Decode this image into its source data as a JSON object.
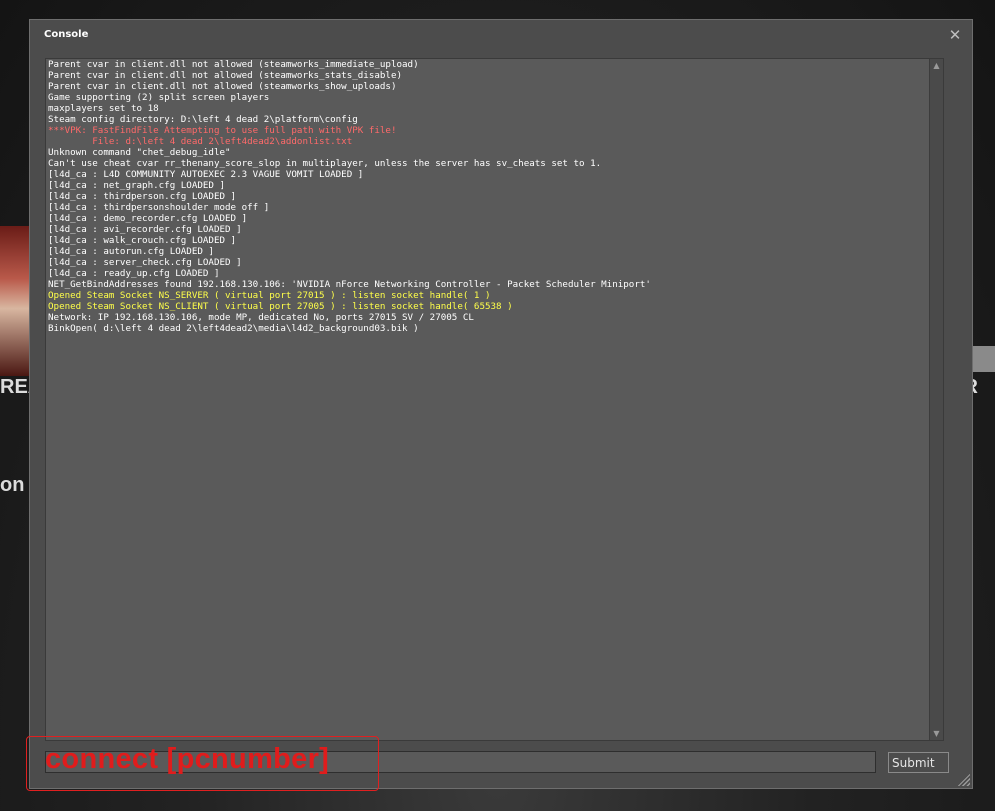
{
  "background": {
    "left_text_1": "REA",
    "left_text_2": "on",
    "right_text": "R"
  },
  "console": {
    "title": "Console",
    "close_glyph": "✕",
    "submit_label": "Submit",
    "input_value": "",
    "colors": {
      "normal": "#ffffff",
      "error": "#ff6a6a",
      "warning": "#ffff4a"
    },
    "log": [
      {
        "text": "Parent cvar in client.dll not allowed (steamworks_immediate_upload)",
        "level": "normal"
      },
      {
        "text": "Parent cvar in client.dll not allowed (steamworks_stats_disable)",
        "level": "normal"
      },
      {
        "text": "Parent cvar in client.dll not allowed (steamworks_show_uploads)",
        "level": "normal"
      },
      {
        "text": "Game supporting (2) split screen players",
        "level": "normal"
      },
      {
        "text": "maxplayers set to 18",
        "level": "normal"
      },
      {
        "text": "Steam config directory: D:\\left 4 dead 2\\platform\\config",
        "level": "normal"
      },
      {
        "text": "***VPK: FastFindFile Attempting to use full path with VPK file!",
        "level": "error"
      },
      {
        "text": "        File: d:\\left 4 dead 2\\left4dead2\\addonlist.txt",
        "level": "error"
      },
      {
        "text": "Unknown command \"chet_debug_idle\"",
        "level": "normal"
      },
      {
        "text": "Can't use cheat cvar rr_thenany_score_slop in multiplayer, unless the server has sv_cheats set to 1.",
        "level": "normal"
      },
      {
        "text": "[l4d_ca : L4D COMMUNITY AUTOEXEC 2.3 VAGUE VOMIT LOADED ]",
        "level": "normal"
      },
      {
        "text": "[l4d_ca : net_graph.cfg LOADED ]",
        "level": "normal"
      },
      {
        "text": "[l4d_ca : thirdperson.cfg LOADED ]",
        "level": "normal"
      },
      {
        "text": "[l4d_ca : thirdpersonshoulder mode off ]",
        "level": "normal"
      },
      {
        "text": "[l4d_ca : demo_recorder.cfg LOADED ]",
        "level": "normal"
      },
      {
        "text": "[l4d_ca : avi_recorder.cfg LOADED ]",
        "level": "normal"
      },
      {
        "text": "[l4d_ca : walk_crouch.cfg LOADED ]",
        "level": "normal"
      },
      {
        "text": "[l4d_ca : autorun.cfg LOADED ]",
        "level": "normal"
      },
      {
        "text": "[l4d_ca : server_check.cfg LOADED ]",
        "level": "normal"
      },
      {
        "text": "[l4d_ca : ready_up.cfg LOADED ]",
        "level": "normal"
      },
      {
        "text": "NET_GetBindAddresses found 192.168.130.106: 'NVIDIA nForce Networking Controller - Packet Scheduler Miniport'",
        "level": "normal"
      },
      {
        "text": "Opened Steam Socket NS_SERVER ( virtual port 27015 ) : listen socket handle( 1 )",
        "level": "warning"
      },
      {
        "text": "Opened Steam Socket NS_CLIENT ( virtual port 27005 ) : listen socket handle( 65538 )",
        "level": "warning"
      },
      {
        "text": "Network: IP 192.168.130.106, mode MP, dedicated No, ports 27015 SV / 27005 CL",
        "level": "normal"
      },
      {
        "text": "BinkOpen( d:\\left 4 dead 2\\left4dead2\\media\\l4d2_background03.bik )",
        "level": "normal"
      }
    ]
  },
  "annotation": {
    "text": "connect [pcnumber]",
    "color": "#e01c1c"
  }
}
